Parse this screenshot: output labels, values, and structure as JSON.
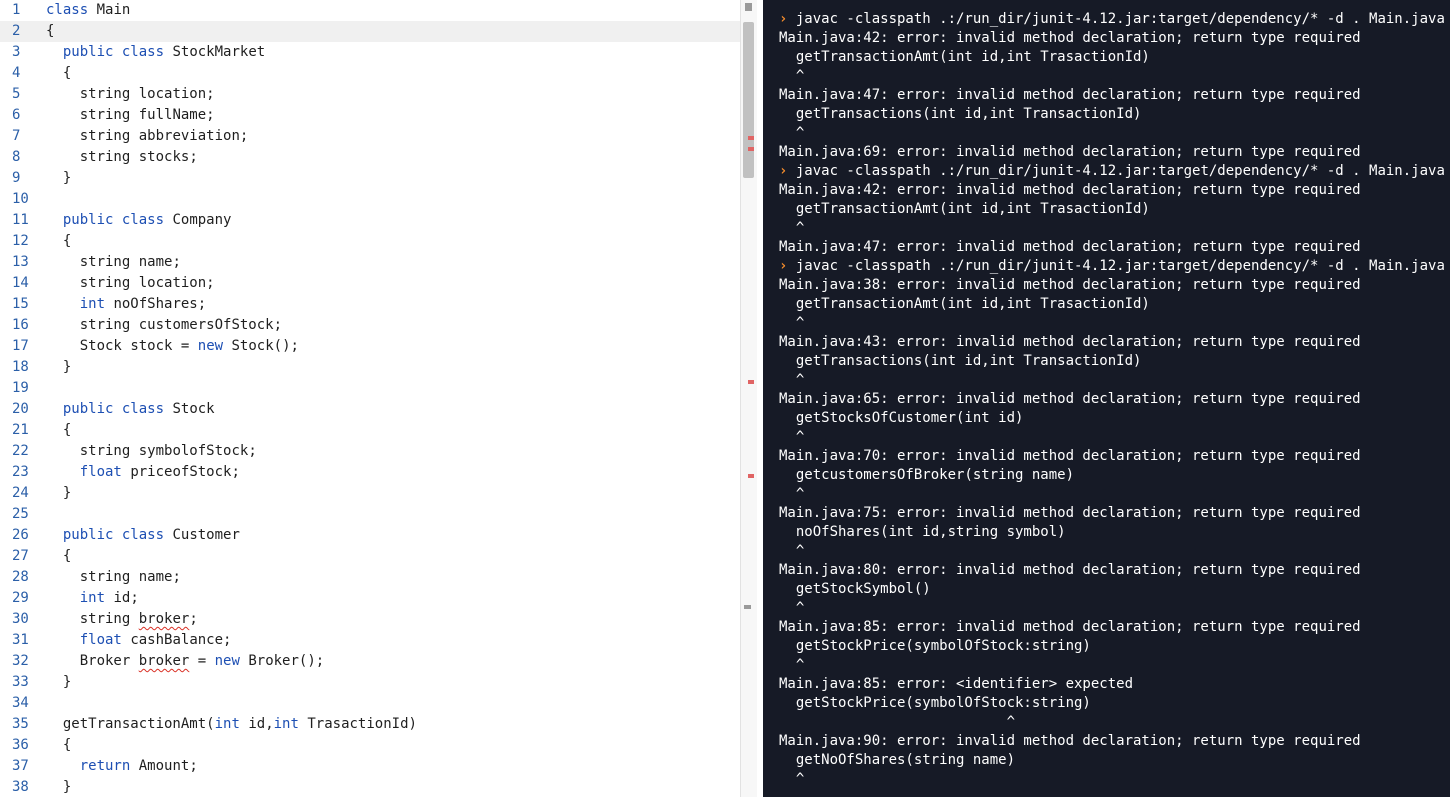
{
  "editor": {
    "active_line": 2,
    "lines": [
      "class Main",
      "{",
      "  public class StockMarket",
      "  {",
      "    string location;",
      "    string fullName;",
      "    string abbreviation;",
      "    string stocks;",
      "  }",
      "",
      "  public class Company",
      "  {",
      "    string name;",
      "    string location;",
      "    int noOfShares;",
      "    string customersOfStock;",
      "    Stock stock = new Stock();",
      "  }",
      "",
      "  public class Stock",
      "  {",
      "    string symbolofStock;",
      "    float priceofStock;",
      "  }",
      "",
      "  public class Customer",
      "  {",
      "    string name;",
      "    int id;",
      "    string broker;",
      "    float cashBalance;",
      "    Broker broker = new Broker();",
      "  }",
      "",
      "  getTransactionAmt(int id,int TrasactionId)",
      "  {",
      "    return Amount;",
      "  }"
    ],
    "keywords": [
      "class",
      "public",
      "int",
      "float",
      "new",
      "return"
    ],
    "squiggle_word": "broker",
    "squiggle_lines": [
      30,
      32
    ]
  },
  "terminal": {
    "prompt_symbol": "›",
    "lines": [
      {
        "prompt": true,
        "text": "javac -classpath .:/run_dir/junit-4.12.jar:target/dependency/* -d . Main.java"
      },
      {
        "text": "Main.java:42: error: invalid method declaration; return type required"
      },
      {
        "text": "  getTransactionAmt(int id,int TrasactionId)"
      },
      {
        "text": "  ^"
      },
      {
        "text": "Main.java:47: error: invalid method declaration; return type required"
      },
      {
        "text": "  getTransactions(int id,int TransactionId)"
      },
      {
        "text": "  ^"
      },
      {
        "text": "Main.java:69: error: invalid method declaration; return type required"
      },
      {
        "prompt": true,
        "text": "javac -classpath .:/run_dir/junit-4.12.jar:target/dependency/* -d . Main.java"
      },
      {
        "text": "Main.java:42: error: invalid method declaration; return type required"
      },
      {
        "text": "  getTransactionAmt(int id,int TrasactionId)"
      },
      {
        "text": "  ^"
      },
      {
        "text": "Main.java:47: error: invalid method declaration; return type required"
      },
      {
        "prompt": true,
        "text": "javac -classpath .:/run_dir/junit-4.12.jar:target/dependency/* -d . Main.java"
      },
      {
        "text": "Main.java:38: error: invalid method declaration; return type required"
      },
      {
        "text": "  getTransactionAmt(int id,int TrasactionId)"
      },
      {
        "text": "  ^"
      },
      {
        "text": "Main.java:43: error: invalid method declaration; return type required"
      },
      {
        "text": "  getTransactions(int id,int TransactionId)"
      },
      {
        "text": "  ^"
      },
      {
        "text": "Main.java:65: error: invalid method declaration; return type required"
      },
      {
        "text": "  getStocksOfCustomer(int id)"
      },
      {
        "text": "  ^"
      },
      {
        "text": "Main.java:70: error: invalid method declaration; return type required"
      },
      {
        "text": "  getcustomersOfBroker(string name)"
      },
      {
        "text": "  ^"
      },
      {
        "text": "Main.java:75: error: invalid method declaration; return type required"
      },
      {
        "text": "  noOfShares(int id,string symbol)"
      },
      {
        "text": "  ^"
      },
      {
        "text": "Main.java:80: error: invalid method declaration; return type required"
      },
      {
        "text": "  getStockSymbol()"
      },
      {
        "text": "  ^"
      },
      {
        "text": "Main.java:85: error: invalid method declaration; return type required"
      },
      {
        "text": "  getStockPrice(symbolOfStock:string)"
      },
      {
        "text": "  ^"
      },
      {
        "text": "Main.java:85: error: <identifier> expected"
      },
      {
        "text": "  getStockPrice(symbolOfStock:string)"
      },
      {
        "text": "                           ^"
      },
      {
        "text": "Main.java:90: error: invalid method declaration; return type required"
      },
      {
        "text": "  getNoOfShares(string name)"
      },
      {
        "text": "  ^"
      }
    ]
  },
  "colors": {
    "editor_bg": "#ffffff",
    "line_number": "#2b5fa8",
    "keyword": "#1d4fb3",
    "terminal_bg": "#161a26",
    "terminal_text": "#ffffff",
    "prompt": "#f28b2c",
    "error_marker": "#e06464"
  }
}
